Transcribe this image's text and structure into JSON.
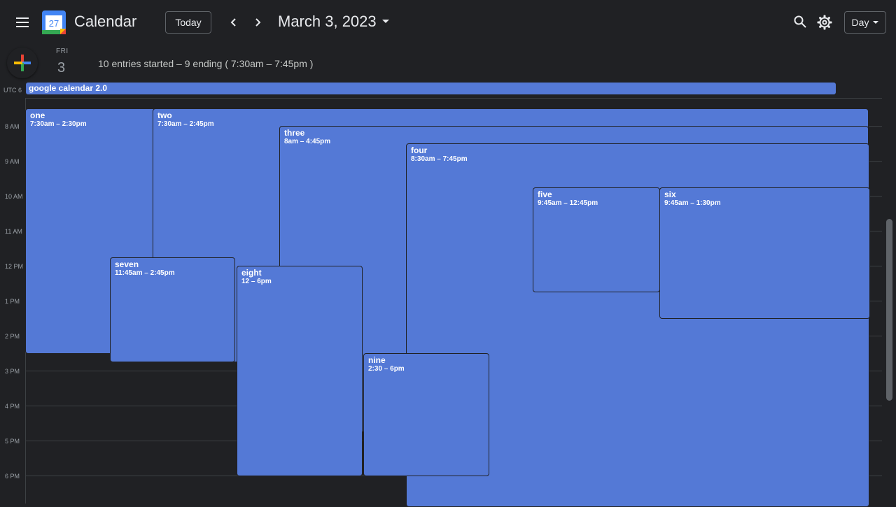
{
  "header": {
    "app_title": "Calendar",
    "logo_day": "27",
    "today_label": "Today",
    "date_title": "March 3, 2023",
    "view_label": "Day"
  },
  "day": {
    "dow": "FRI",
    "number": "3",
    "summary": "10 entries started – 9 ending ( 7:30am – 7:45pm )",
    "timezone": "UTC 6"
  },
  "all_day_event": "google calendar 2.0",
  "hours": [
    "8 AM",
    "9 AM",
    "10 AM",
    "11 AM",
    "12 PM",
    "1 PM",
    "2 PM",
    "3 PM",
    "4 PM",
    "5 PM",
    "6 PM"
  ],
  "events": [
    {
      "name": "one",
      "time": "7:30am – 2:30pm"
    },
    {
      "name": "two",
      "time": "7:30am – 2:45pm"
    },
    {
      "name": "three",
      "time": "8am – 4:45pm"
    },
    {
      "name": "four",
      "time": "8:30am – 7:45pm"
    },
    {
      "name": "five",
      "time": "9:45am – 12:45pm"
    },
    {
      "name": "six",
      "time": "9:45am – 1:30pm"
    },
    {
      "name": "seven",
      "time": "11:45am – 2:45pm"
    },
    {
      "name": "eight",
      "time": "12 – 6pm"
    },
    {
      "name": "nine",
      "time": "2:30 – 6pm"
    }
  ],
  "colors": {
    "background": "#202124",
    "event": "#5479d6",
    "gridline": "#3c4043",
    "logo_blue": "#4285f4",
    "logo_red": "#ea4335",
    "logo_yellow": "#fbbc04",
    "logo_green": "#34a853"
  },
  "icons": [
    "menu-icon",
    "calendar-logo-icon",
    "chevron-left-icon",
    "chevron-right-icon",
    "dropdown-arrow-icon",
    "search-icon",
    "gear-icon",
    "plus-icon"
  ]
}
